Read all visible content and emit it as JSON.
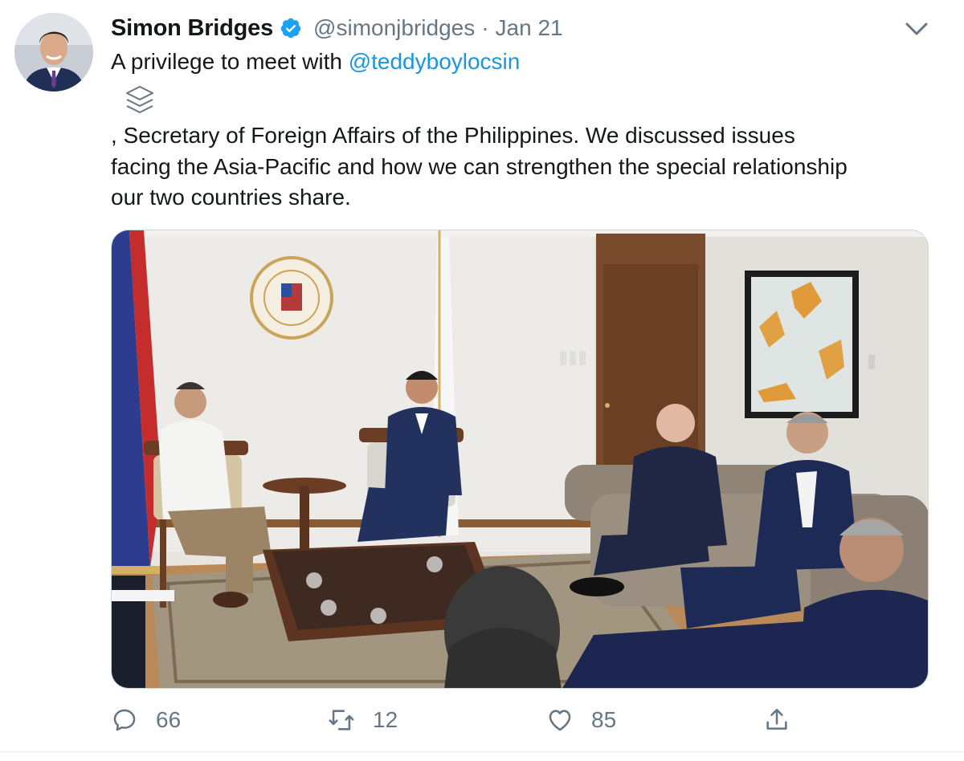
{
  "tweet": {
    "author": {
      "display_name": "Simon Bridges",
      "handle": "@simonjbridges",
      "verified": true,
      "avatar_icon": "profile-photo"
    },
    "separator": "·",
    "date": "Jan 21",
    "text": {
      "line1_prefix": "A privilege to meet with ",
      "line1_mention": "@teddyboylocsin",
      "line2": ", Secretary of Foreign Affairs of the Philippines. We discussed issues",
      "line3": "facing the Asia-Pacific and how we can strengthen the special relationship",
      "line4": "our two countries share."
    },
    "inline_icon": "stack-layers-icon",
    "menu_icon": "chevron-down-icon",
    "media": {
      "type": "photo"
    },
    "actions": {
      "reply_count": "66",
      "retweet_count": "12",
      "like_count": "85"
    }
  },
  "colors": {
    "text": "#14171a",
    "secondary": "#657786",
    "link": "#1b95e0",
    "verified": "#1da1f2",
    "border": "#ccd6dd"
  }
}
